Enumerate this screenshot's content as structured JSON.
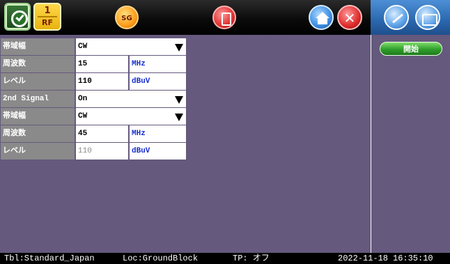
{
  "toolbar": {
    "rf_number": "1",
    "rf_label": "RF",
    "sg_label": "SG",
    "close_glyph": "✕",
    "icons": [
      "meter-icon",
      "sg-icon",
      "save-icon",
      "home-icon",
      "close-icon",
      "settings-icon",
      "folder-icon"
    ]
  },
  "settings": {
    "rows": [
      {
        "label": "帯域幅",
        "value": "CW",
        "kind": "select"
      },
      {
        "label": "周波数",
        "value": "15",
        "unit": "MHz",
        "kind": "value"
      },
      {
        "label": "レベル",
        "value": "110",
        "unit": "dBuV",
        "kind": "value"
      },
      {
        "label": "2nd Signal",
        "value": "On",
        "kind": "select"
      },
      {
        "label": "帯域幅",
        "value": "CW",
        "kind": "select"
      },
      {
        "label": "周波数",
        "value": "45",
        "unit": "MHz",
        "kind": "value"
      },
      {
        "label": "レベル",
        "value": "110",
        "unit": "dBuV",
        "kind": "value",
        "dim": true
      }
    ]
  },
  "right_panel": {
    "start_label": "開始"
  },
  "status": {
    "table": "Tbl:Standard_Japan",
    "location": "Loc:GroundBlock",
    "tp": "TP: オフ",
    "date": "2022-11-18",
    "time": "16:35:10"
  },
  "colors": {
    "background": "#65597d",
    "label_cell": "#8a8a8a",
    "unit_text": "#1a2fd0",
    "start_button": "#2f9d2a"
  }
}
